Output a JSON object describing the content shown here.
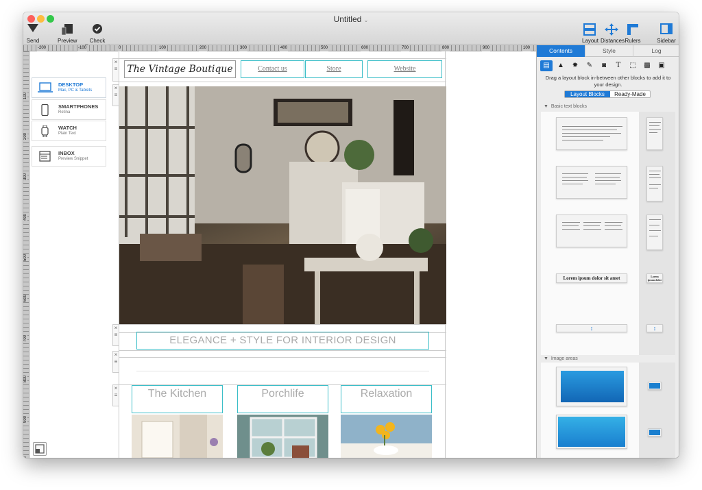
{
  "window": {
    "title": "Untitled"
  },
  "toolbar": {
    "send": "Send",
    "preview": "Preview",
    "check_document": "Check Document",
    "layout": "Layout",
    "distances": "Distances",
    "rulers": "Rulers",
    "sidebar": "Sidebar"
  },
  "rulers": {
    "h_ticks": [
      "-200",
      "-100",
      "0",
      "100",
      "200",
      "300",
      "400",
      "500",
      "600",
      "700",
      "800",
      "900",
      "100"
    ],
    "v_ticks": [
      "100",
      "200",
      "300",
      "400",
      "500",
      "600",
      "700",
      "800",
      "900",
      "100"
    ]
  },
  "devices": [
    {
      "name": "DESKTOP",
      "sub": "Mac, PC & Tablets",
      "icon": "laptop-icon"
    },
    {
      "name": "SMARTPHONES",
      "sub": "Retina",
      "icon": "smartphone-icon"
    },
    {
      "name": "WATCH",
      "sub": "Plain Text",
      "icon": "watch-icon"
    },
    {
      "name": "INBOX",
      "sub": "Preview Snippet",
      "icon": "inbox-icon"
    }
  ],
  "email": {
    "logo": "The Vintage Boutique",
    "nav": [
      "Contact us",
      "Store",
      "Website"
    ],
    "tagline": "ELEGANCE + STYLE FOR INTERIOR DESIGN",
    "categories": [
      "The Kitchen",
      "Porchlife",
      "Relaxation"
    ]
  },
  "sidebar": {
    "tabs": [
      "Contents",
      "Style",
      "Log"
    ],
    "hint": "Drag a layout block in-between other blocks to add it to your design.",
    "segments": [
      "Layout Blocks",
      "Ready-Made"
    ],
    "groups": [
      "Basic text blocks",
      "Image areas"
    ],
    "sample_heading": "Lorem ipsum dolor sit amet",
    "sample_heading_small": "Lorem ipsum dolor sit amet"
  },
  "colors": {
    "accent": "#1f7ad6",
    "guide": "#3bbec8"
  }
}
